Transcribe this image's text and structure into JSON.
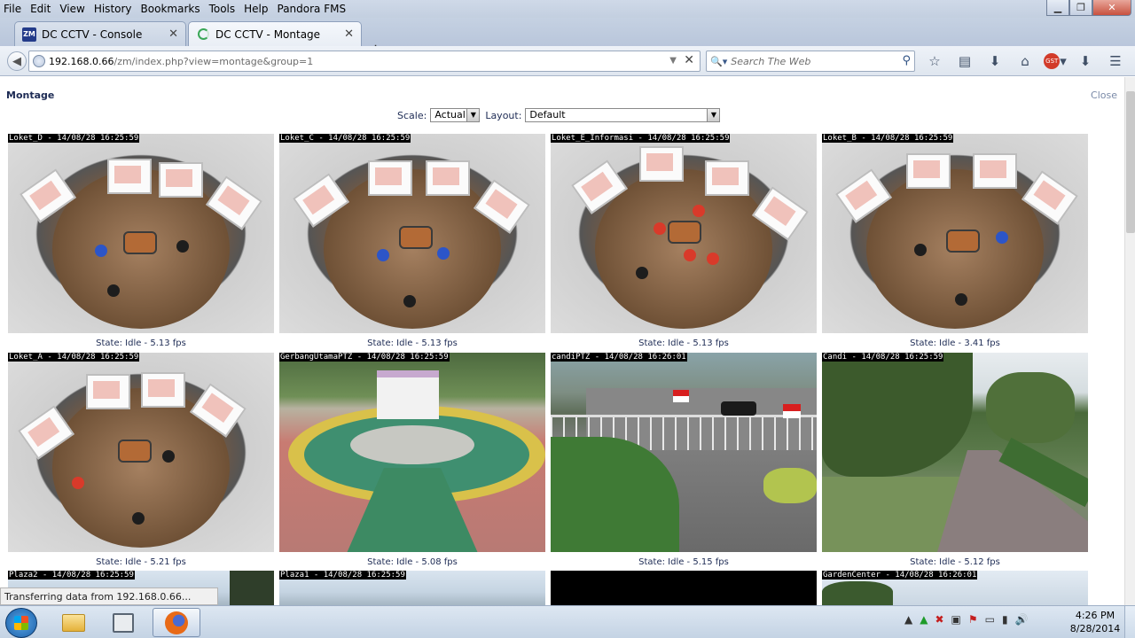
{
  "browser": {
    "menu": [
      "File",
      "Edit",
      "View",
      "History",
      "Bookmarks",
      "Tools",
      "Help",
      "Pandora FMS"
    ],
    "window_controls": {
      "minimize": "▁",
      "maximize": "❐",
      "close": "✕"
    },
    "tabs": [
      {
        "title": "DC CCTV - Console",
        "favicon": "ZM",
        "favicon_name": "zoneminder-icon"
      },
      {
        "title": "DC CCTV - Montage",
        "favicon": "",
        "favicon_name": "loading-spinner-icon"
      }
    ],
    "new_tab": "+",
    "url_host": "192.168.0.66",
    "url_path": "/zm/index.php?view=montage&group=1",
    "search_placeholder": "Search The Web",
    "status_text": "Transferring data from 192.168.0.66...",
    "toolbar_icons": [
      "star-icon",
      "reading-list-icon",
      "download-icon",
      "home-icon",
      "ghostery-icon",
      "addon-icon",
      "menu-icon"
    ]
  },
  "page": {
    "title": "Montage",
    "close_label": "Close",
    "scale_label": "Scale:",
    "scale_value": "Actual",
    "layout_label": "Layout:",
    "layout_value": "Default"
  },
  "monitors": [
    {
      "overlay": "Loket_D - 14/08/28 16:25:59",
      "state": "State: Idle - 5.13 fps",
      "scene": "office"
    },
    {
      "overlay": "Loket_C - 14/08/28 16:25:59",
      "state": "State: Idle - 5.13 fps",
      "scene": "office"
    },
    {
      "overlay": "Loket_E_Informasi - 14/08/28 16:25:59",
      "state": "State: Idle - 5.13 fps",
      "scene": "office"
    },
    {
      "overlay": "Loket_B - 14/08/28 16:25:59",
      "state": "State: Idle - 3.41 fps",
      "scene": "office"
    },
    {
      "overlay": "Loket_A - 14/08/28 16:25:59",
      "state": "State: Idle - 5.21 fps",
      "scene": "office"
    },
    {
      "overlay": "GerbangUtamaPTZ - 14/08/28 16:25:59",
      "state": "State: Idle - 5.08 fps",
      "scene": "plaza-ptz"
    },
    {
      "overlay": "candiPTZ - 14/08/28 16:26:01",
      "state": "State: Idle - 5.15 fps",
      "scene": "gate"
    },
    {
      "overlay": "Candi - 14/08/28 16:25:59",
      "state": "State: Idle - 5.12 fps",
      "scene": "garden"
    },
    {
      "overlay": "Plaza2 - 14/08/28 16:25:59",
      "state": "",
      "scene": "plaza-b"
    },
    {
      "overlay": "Plaza1 - 14/08/28 16:25:59",
      "state": "",
      "scene": "plaza-b"
    },
    {
      "overlay": "",
      "state": "",
      "scene": "black-feed"
    },
    {
      "overlay": "GardenCenter - 14/08/28 16:26:01",
      "state": "",
      "scene": "garden-center"
    }
  ],
  "taskbar": {
    "apps": [
      "windows-explorer",
      "media-center",
      "firefox"
    ],
    "tray_icons": [
      "show-hidden-icons",
      "network-green-icon",
      "security-icon",
      "app-icon",
      "flag-icon",
      "display-icon",
      "signal-icon",
      "volume-icon"
    ],
    "time": "4:26 PM",
    "date": "8/28/2014"
  }
}
